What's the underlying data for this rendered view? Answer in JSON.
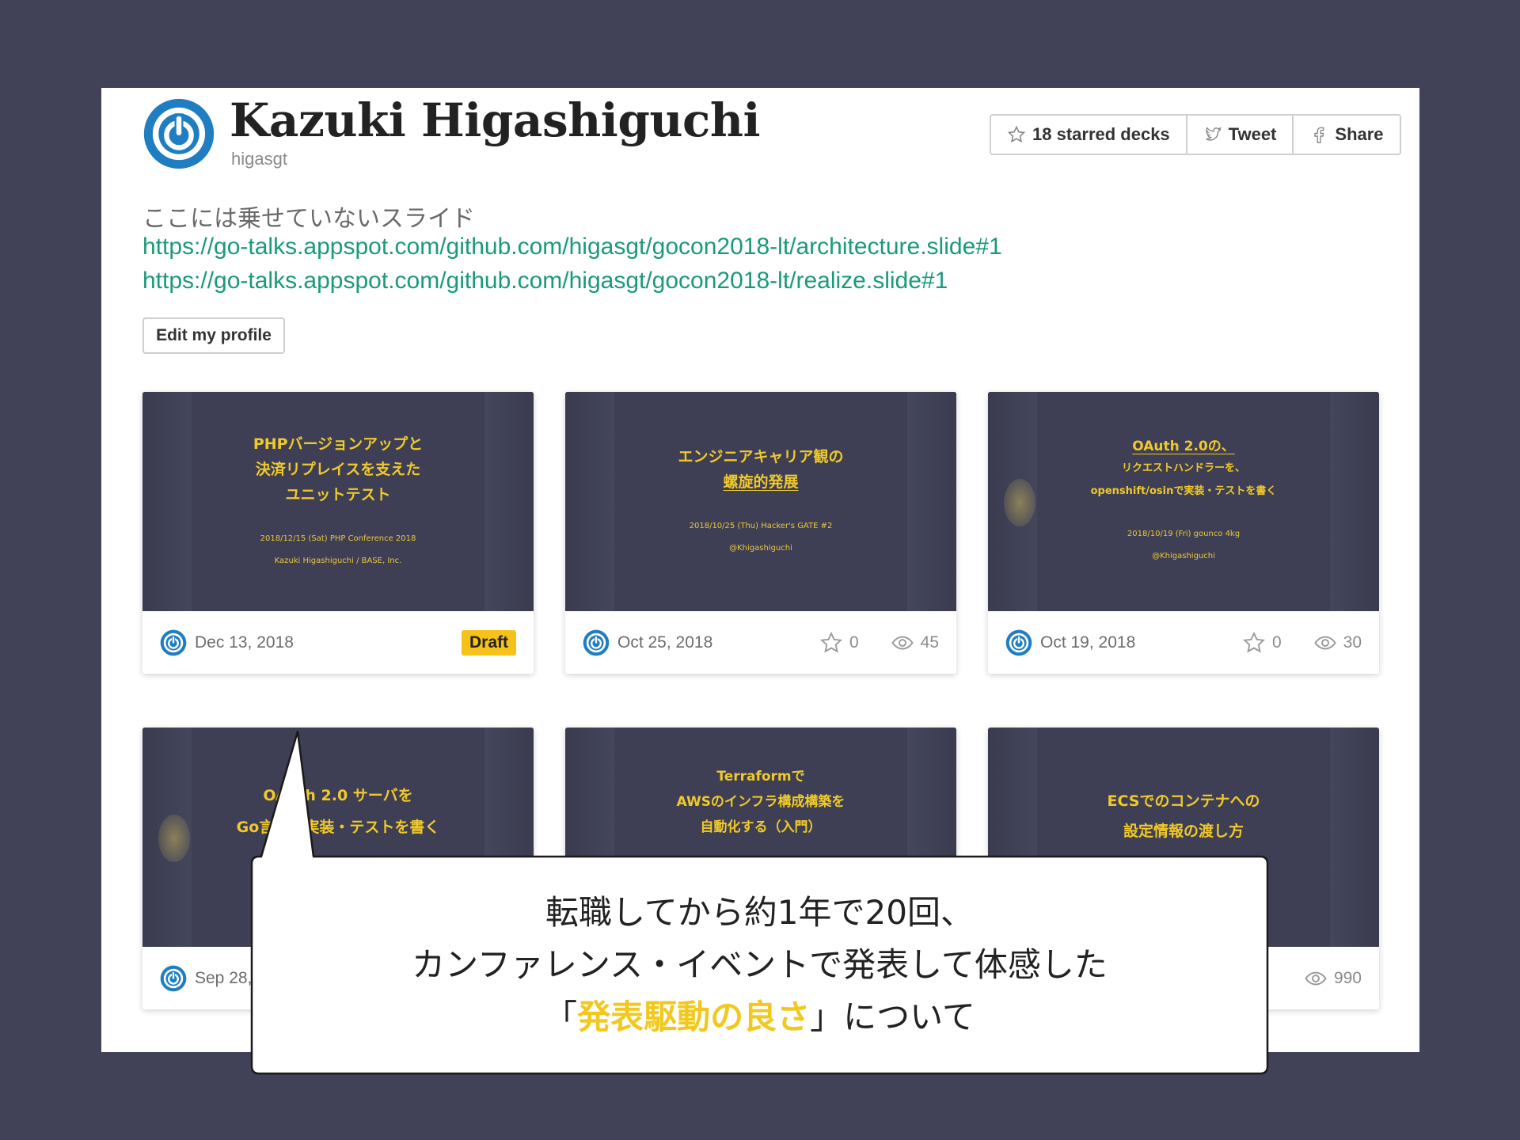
{
  "profile": {
    "name": "Kazuki Higashiguchi",
    "handle": "higasgt",
    "bio": "ここには乗せていないスライド",
    "links": [
      "https://go-talks.appspot.com/github.com/higasgt/gocon2018-lt/architecture.slide#1",
      "https://go-talks.appspot.com/github.com/higasgt/gocon2018-lt/realize.slide#1"
    ],
    "edit_label": "Edit my profile"
  },
  "actions": {
    "starred": "18 starred decks",
    "tweet": "Tweet",
    "share": "Share"
  },
  "decks": [
    {
      "title_lines": [
        "PHPバージョンアップと",
        "決済リプレイスを支えた",
        "ユニットテスト"
      ],
      "sub_lines": [
        "2018/12/15 (Sat) PHP Conference 2018",
        "Kazuki Higashiguchi / BASE, Inc."
      ],
      "date": "Dec 13, 2018",
      "badge": "Draft"
    },
    {
      "title_lines": [
        "エンジニアキャリア観の",
        "螺旋的発展"
      ],
      "sub_lines": [
        "2018/10/25 (Thu) Hacker's GATE #2",
        "@Khigashiguchi"
      ],
      "date": "Oct 25, 2018",
      "stars": "0",
      "views": "45"
    },
    {
      "title_lines": [
        "OAuth 2.0の、",
        "リクエストハンドラーを、",
        "openshift/osinで実装・テストを書く"
      ],
      "sub_lines": [
        "2018/10/19 (Fri) gounco 4kg",
        "@Khigashiguchi"
      ],
      "date": "Oct 19, 2018",
      "stars": "0",
      "views": "30"
    },
    {
      "title_lines": [
        "OAuth 2.0 サーバを",
        "Go言語で実装・テストを書く"
      ],
      "date": "Sep 28, 2018"
    },
    {
      "title_lines": [
        "Terraformで",
        "AWSのインフラ構成構築を",
        "自動化する（入門）"
      ]
    },
    {
      "title_lines": [
        "ECSでのコンテナへの",
        "設定情報の渡し方"
      ],
      "views": "990"
    }
  ],
  "callout": {
    "line1": "転職してから約1年で20回、",
    "line2": "カンファレンス・イベントで発表して体感した",
    "line3_open": "「",
    "line3_highlight": "発表駆動の良さ",
    "line3_close": "」について"
  },
  "colors": {
    "background": "#414258",
    "slide": "#3e3f54",
    "accent_yellow": "#f0c92a",
    "link": "#1a9a7a",
    "avatar_blue": "#1f7ec2"
  },
  "icons": [
    "power-avatar-icon",
    "star-icon",
    "twitter-bird-icon",
    "facebook-icon",
    "eye-icon"
  ]
}
